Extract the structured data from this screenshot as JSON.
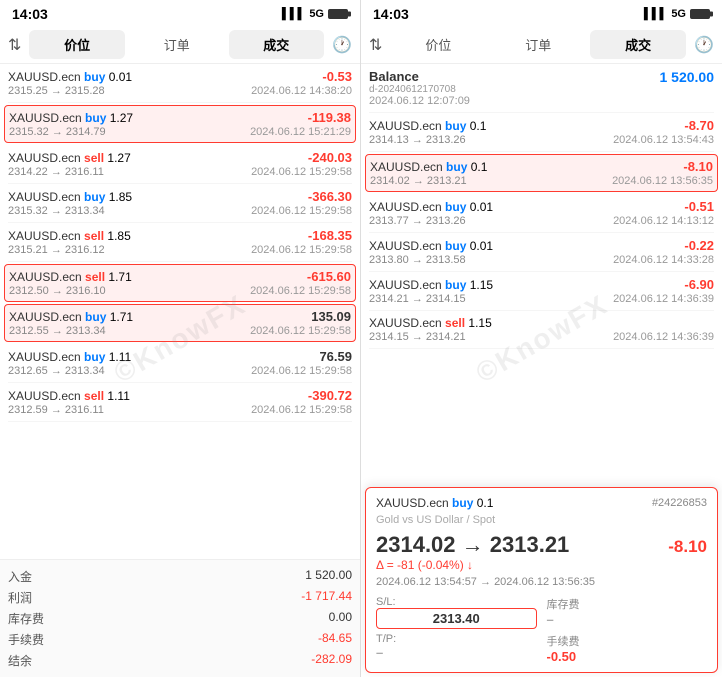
{
  "left": {
    "time": "14:03",
    "signal": "5G",
    "tabs": [
      {
        "label": "价位",
        "active": false
      },
      {
        "label": "订单",
        "active": false
      },
      {
        "label": "成交",
        "active": true
      }
    ],
    "trades": [
      {
        "instrument": "XAUUSD.ecn",
        "direction": "buy",
        "volume": "0.01",
        "price_from": "2315.25",
        "price_to": "2315.28",
        "date": "2024.06.12 14:38:20",
        "pnl": "-0.53",
        "pnl_positive": false
      },
      {
        "instrument": "XAUUSD.ecn",
        "direction": "buy",
        "volume": "1.27",
        "price_from": "2315.32",
        "price_to": "2314.79",
        "date": "2024.06.12 15:21:29",
        "pnl": "-119.38",
        "pnl_positive": false,
        "highlighted": true
      },
      {
        "instrument": "XAUUSD.ecn",
        "direction": "sell",
        "volume": "1.27",
        "price_from": "2314.22",
        "price_to": "2316.11",
        "date": "2024.06.12 15:29:58",
        "pnl": "-240.03",
        "pnl_positive": false
      },
      {
        "instrument": "XAUUSD.ecn",
        "direction": "buy",
        "volume": "1.85",
        "price_from": "2315.32",
        "price_to": "2313.34",
        "date": "2024.06.12 15:29:58",
        "pnl": "-366.30",
        "pnl_positive": false
      },
      {
        "instrument": "XAUUSD.ecn",
        "direction": "sell",
        "volume": "1.85",
        "price_from": "2315.21",
        "price_to": "2316.12",
        "date": "2024.06.12 15:29:58",
        "pnl": "-168.35",
        "pnl_positive": false
      },
      {
        "instrument": "XAUUSD.ecn",
        "direction": "sell",
        "volume": "1.71",
        "price_from": "2312.50",
        "price_to": "2316.10",
        "date": "2024.06.12 15:29:58",
        "pnl": "-615.60",
        "pnl_positive": false,
        "highlighted": true
      },
      {
        "instrument": "XAUUSD.ecn",
        "direction": "buy",
        "volume": "1.71",
        "price_from": "2312.55",
        "price_to": "2313.34",
        "date": "2024.06.12 15:29:58",
        "pnl": "135.09",
        "pnl_positive": true,
        "highlighted": true
      },
      {
        "instrument": "XAUUSD.ecn",
        "direction": "buy",
        "volume": "1.11",
        "price_from": "2312.65",
        "price_to": "2313.34",
        "date": "2024.06.12 15:29:58",
        "pnl": "76.59",
        "pnl_positive": true
      },
      {
        "instrument": "XAUUSD.ecn",
        "direction": "sell",
        "volume": "1.11",
        "price_from": "2312.59",
        "price_to": "2316.11",
        "date": "2024.06.12 15:29:58",
        "pnl": "-390.72",
        "pnl_positive": false
      }
    ],
    "summary": [
      {
        "label": "入金",
        "value": "1 520.00",
        "negative": false
      },
      {
        "label": "利润",
        "value": "-1 717.44",
        "negative": true
      },
      {
        "label": "库存费",
        "value": "0.00",
        "negative": false
      },
      {
        "label": "手续费",
        "value": "-84.65",
        "negative": true
      },
      {
        "label": "结余",
        "value": "-282.09",
        "negative": true
      }
    ]
  },
  "right": {
    "time": "14:03",
    "signal": "5G",
    "tabs": [
      {
        "label": "价位",
        "active": false
      },
      {
        "label": "订单",
        "active": false
      },
      {
        "label": "成交",
        "active": true
      }
    ],
    "balance": {
      "label": "Balance",
      "sub": "d-20240612170708",
      "date": "2024.06.12 12:07:09",
      "value": "1 520.00"
    },
    "trades": [
      {
        "instrument": "XAUUSD.ecn",
        "direction": "buy",
        "volume": "0.1",
        "price_from": "2314.13",
        "price_to": "2313.26",
        "date": "2024.06.12 13:54:43",
        "pnl": "-8.70",
        "pnl_positive": false
      },
      {
        "instrument": "XAUUSD.ecn",
        "direction": "buy",
        "volume": "0.1",
        "price_from": "2314.02",
        "price_to": "2313.21",
        "date": "2024.06.12 13:56:35",
        "pnl": "-8.10",
        "pnl_positive": false,
        "highlighted": true
      },
      {
        "instrument": "XAUUSD.ecn",
        "direction": "buy",
        "volume": "0.01",
        "price_from": "2313.77",
        "price_to": "2313.26",
        "date": "2024.06.12 14:13:12",
        "pnl": "-0.51",
        "pnl_positive": false
      },
      {
        "instrument": "XAUUSD.ecn",
        "direction": "buy",
        "volume": "0.01",
        "price_from": "2313.80",
        "price_to": "2313.58",
        "date": "2024.06.12 14:33:28",
        "pnl": "-0.22",
        "pnl_positive": false
      },
      {
        "instrument": "XAUUSD.ecn",
        "direction": "buy",
        "volume": "1.15",
        "price_from": "2314.21",
        "price_to": "2314.15",
        "date": "2024.06.12 14:36:39",
        "pnl": "-6.90",
        "pnl_positive": false
      },
      {
        "instrument": "XAUUSD.ecn",
        "direction": "sell",
        "volume": "1.15",
        "price_from": "2314.15",
        "price_to": "2314.21",
        "date": "2024.06.12 14:36:39",
        "pnl": "",
        "pnl_positive": false
      }
    ],
    "popup": {
      "instrument": "XAUUSD.ecn",
      "direction": "buy",
      "volume": "0.1",
      "order_id": "#24226853",
      "subtitle": "Gold vs US Dollar / Spot",
      "price_from": "2314.02",
      "price_to": "2313.21",
      "pnl": "-8.10",
      "delta": "Δ = -81 (-0.04%) ↓",
      "date_from": "2024.06.12 13:54:57",
      "date_to": "2024.06.12 13:56:35",
      "sl_label": "S/L:",
      "sl_value": "2313.40",
      "storage_label": "库存费",
      "storage_value": "–",
      "tp_label": "T/P:",
      "tp_value": "–",
      "commission_label": "手续费",
      "commission_value": "-0.50"
    }
  }
}
